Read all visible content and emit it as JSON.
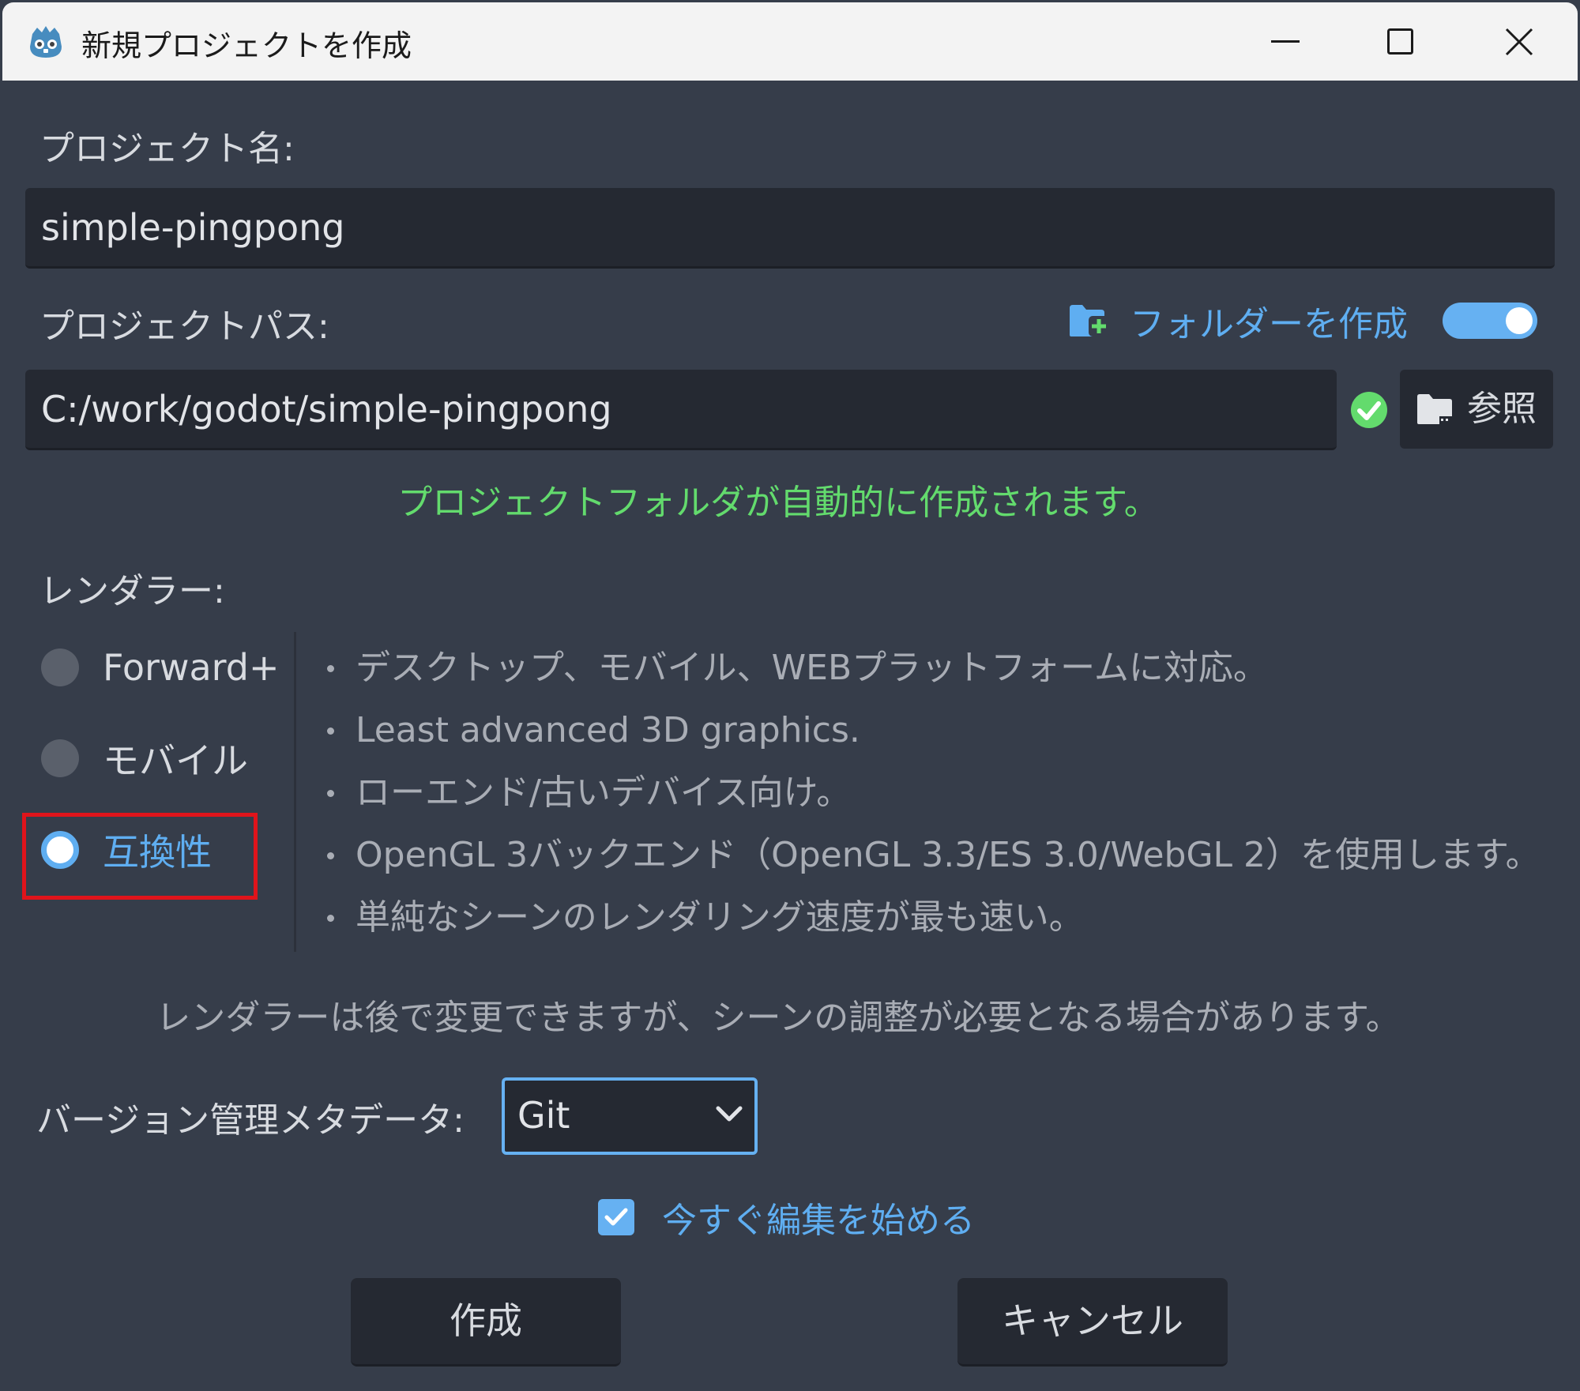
{
  "window": {
    "title": "新規プロジェクトを作成"
  },
  "project_name": {
    "label": "プロジェクト名:",
    "value": "simple-pingpong"
  },
  "project_path": {
    "label": "プロジェクトパス:",
    "value": "C:/work/godot/simple-pingpong",
    "create_folder_label": "フォルダーを作成",
    "create_folder_enabled": true,
    "browse_label": "参照",
    "status_message": "プロジェクトフォルダが自動的に作成されます。"
  },
  "renderer": {
    "label": "レンダラー:",
    "options": [
      {
        "label": "Forward+",
        "selected": false
      },
      {
        "label": "モバイル",
        "selected": false
      },
      {
        "label": "互換性",
        "selected": true
      }
    ],
    "description": [
      "デスクトップ、モバイル、WEBプラットフォームに対応。",
      "Least advanced 3D graphics.",
      "ローエンド/古いデバイス向け。",
      "OpenGL 3バックエンド（OpenGL 3.3/ES 3.0/WebGL 2）を使用します。",
      "単純なシーンのレンダリング速度が最も速い。"
    ],
    "note": "レンダラーは後で変更できますが、シーンの調整が必要となる場合があります。"
  },
  "vcs": {
    "label": "バージョン管理メタデータ:",
    "selected": "Git"
  },
  "edit_now": {
    "label": "今すぐ編集を始める",
    "checked": true
  },
  "buttons": {
    "create": "作成",
    "cancel": "キャンセル"
  },
  "colors": {
    "background": "#363d4a",
    "accent": "#5faef1",
    "success": "#63db6d",
    "highlight": "#e0141b"
  }
}
